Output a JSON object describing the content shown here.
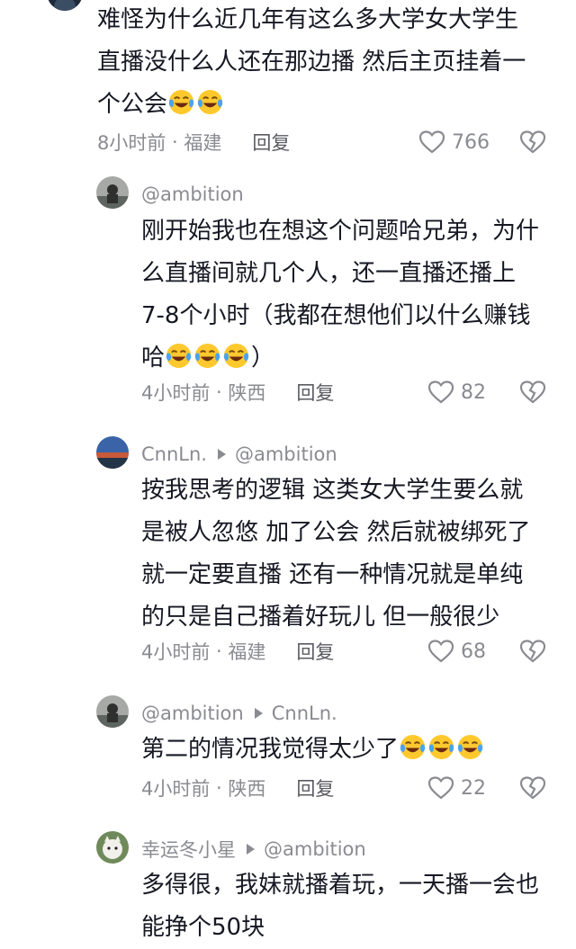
{
  "comments": [
    {
      "text_lines": [
        "难怪为什么近几年有这么多大学女大学生",
        "直播没什么人还在那边播 然后主页挂着一",
        "个公会"
      ],
      "emoji_count": 2,
      "time": "8小时前",
      "location": "福建",
      "reply_label": "回复",
      "likes": "766"
    },
    {
      "author": "@ambition",
      "text_lines": [
        "刚开始我也在想这个问题哈兄弟，为什",
        "么直播间就几个人，还一直播还播上",
        "7-8个小时（我都在想他们以什么赚钱",
        "哈"
      ],
      "emoji_count": 3,
      "text_end": "）",
      "time": "4小时前",
      "location": "陕西",
      "reply_label": "回复",
      "likes": "82"
    },
    {
      "author": "CnnLn.",
      "reply_to": "@ambition",
      "text_lines": [
        "按我思考的逻辑 这类女大学生要么就",
        "是被人忽悠 加了公会 然后就被绑死了",
        "就一定要直播 还有一种情况就是单纯",
        "的只是自己播着好玩儿 但一般很少"
      ],
      "time": "4小时前",
      "location": "福建",
      "reply_label": "回复",
      "likes": "68"
    },
    {
      "author": "@ambition",
      "reply_to": "CnnLn.",
      "text_lines": [
        "第二的情况我觉得太少了"
      ],
      "emoji_count": 3,
      "time": "4小时前",
      "location": "陕西",
      "reply_label": "回复",
      "likes": "22"
    },
    {
      "author": "幸运冬小星",
      "reply_to": "@ambition",
      "text_lines": [
        "多得很，我妹就播着玩，一天播一会也",
        "能挣个50块"
      ]
    }
  ],
  "separator": " · ",
  "icons": {
    "like": "heart-outline-icon",
    "dislike": "broken-heart-icon",
    "emoji": "laughing-crying-emoji",
    "reply_arrow": "triangle-right-icon"
  },
  "colors": {
    "text": "#161823",
    "meta": "#8a8b91",
    "emoji_face": "#ffc92e",
    "emoji_tears": "#4aa3ee"
  }
}
